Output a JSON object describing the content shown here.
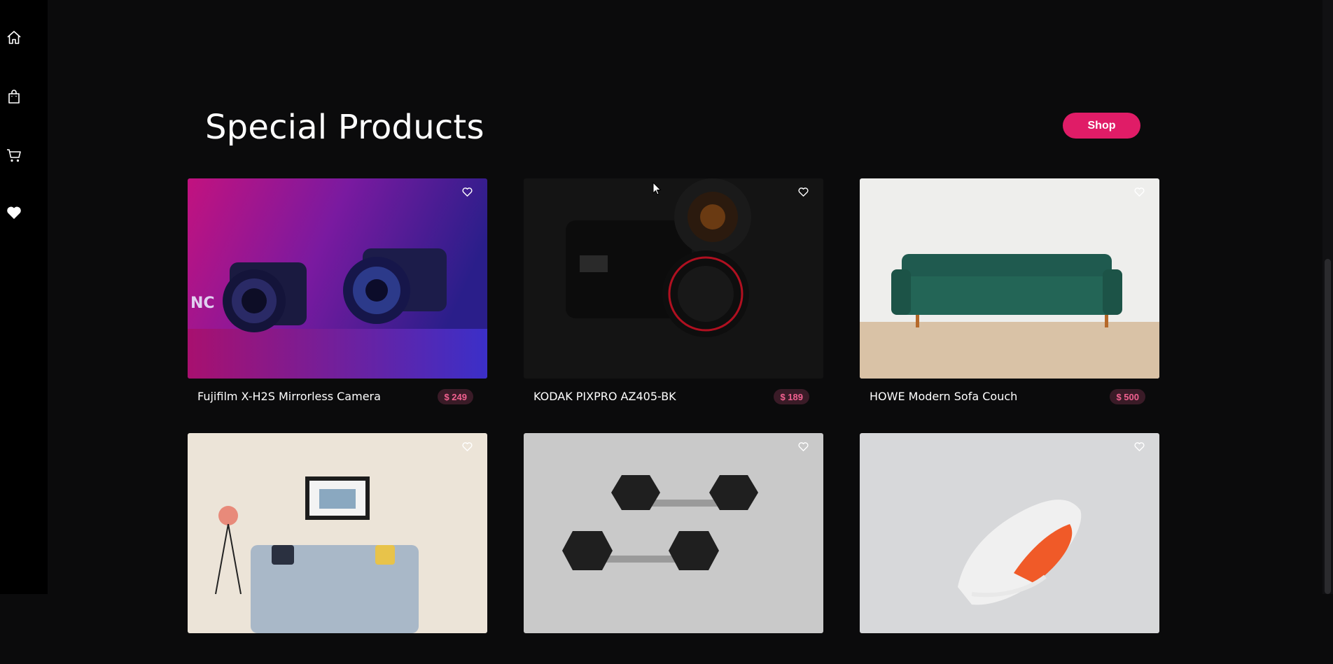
{
  "sidebar": {
    "items": [
      {
        "icon": "home-icon"
      },
      {
        "icon": "shopping-bag-icon"
      },
      {
        "icon": "cart-icon"
      },
      {
        "icon": "heart-filled-icon"
      }
    ]
  },
  "main": {
    "title": "Special Products",
    "shop_label": "Shop"
  },
  "products": [
    {
      "name": "Fujifilm X-H2S Mirrorless Camera",
      "price": "$ 249",
      "image": "camera-purple-photo"
    },
    {
      "name": "KODAK PIXPRO AZ405-BK",
      "price": "$ 189",
      "image": "camera-dark-photo"
    },
    {
      "name": "HOWE Modern Sofa Couch",
      "price": "$ 500",
      "image": "green-sofa-photo"
    },
    {
      "name": "",
      "price": "",
      "image": "living-room-sofa-photo"
    },
    {
      "name": "",
      "price": "",
      "image": "dumbbells-photo"
    },
    {
      "name": "",
      "price": "",
      "image": "sneaker-photo"
    }
  ],
  "colors": {
    "accent": "#e01c67",
    "background": "#0b0b0c",
    "sidebar": "#000000",
    "price_text": "#f0608f",
    "price_bg": "#3a1b27"
  }
}
